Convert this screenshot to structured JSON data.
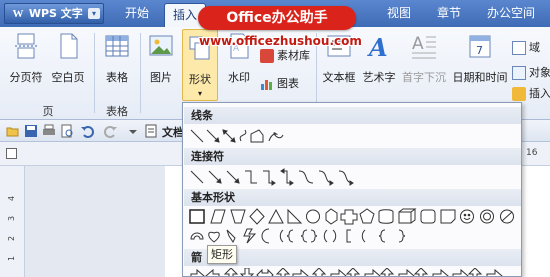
{
  "app": {
    "name": "WPS 文字",
    "menu_arrow": "▾"
  },
  "tabs": [
    {
      "label": "开始"
    },
    {
      "label": "插入"
    },
    {
      "label": "视图"
    },
    {
      "label": "章节"
    },
    {
      "label": "办公空间"
    }
  ],
  "watermark": {
    "badge": "Office办公助手",
    "url": "www.officezhushou.com"
  },
  "ribbon": {
    "page_group": {
      "label": "页",
      "page_break": "分页符",
      "blank_page": "空白页"
    },
    "table_group": {
      "label": "表格",
      "table": "表格"
    },
    "picture": "图片",
    "shapes": "形状",
    "watermark": "水印",
    "material": "素材库",
    "chart": "图表",
    "textbox": "文本框",
    "wordart": "艺术字",
    "dropcap": "首字下沉",
    "datetime": "日期和时间",
    "field": "域",
    "object": "对象",
    "insert": "插入"
  },
  "quickbar": {
    "doc_label": "文档"
  },
  "ruler": {
    "vertical_numbers": [
      "4",
      "3",
      "2",
      "1"
    ],
    "right_numbers": [
      "16"
    ]
  },
  "dropdown": {
    "sections": [
      {
        "title": "线条"
      },
      {
        "title": "连接符"
      },
      {
        "title": "基本形状"
      },
      {
        "title": "箭"
      }
    ]
  },
  "tooltip": {
    "text": "矩形"
  },
  "colors": {
    "tabbar": "#4a78c2",
    "badge": "#d9231b",
    "url": "#c11a12",
    "highlight": "#fde9a9"
  }
}
